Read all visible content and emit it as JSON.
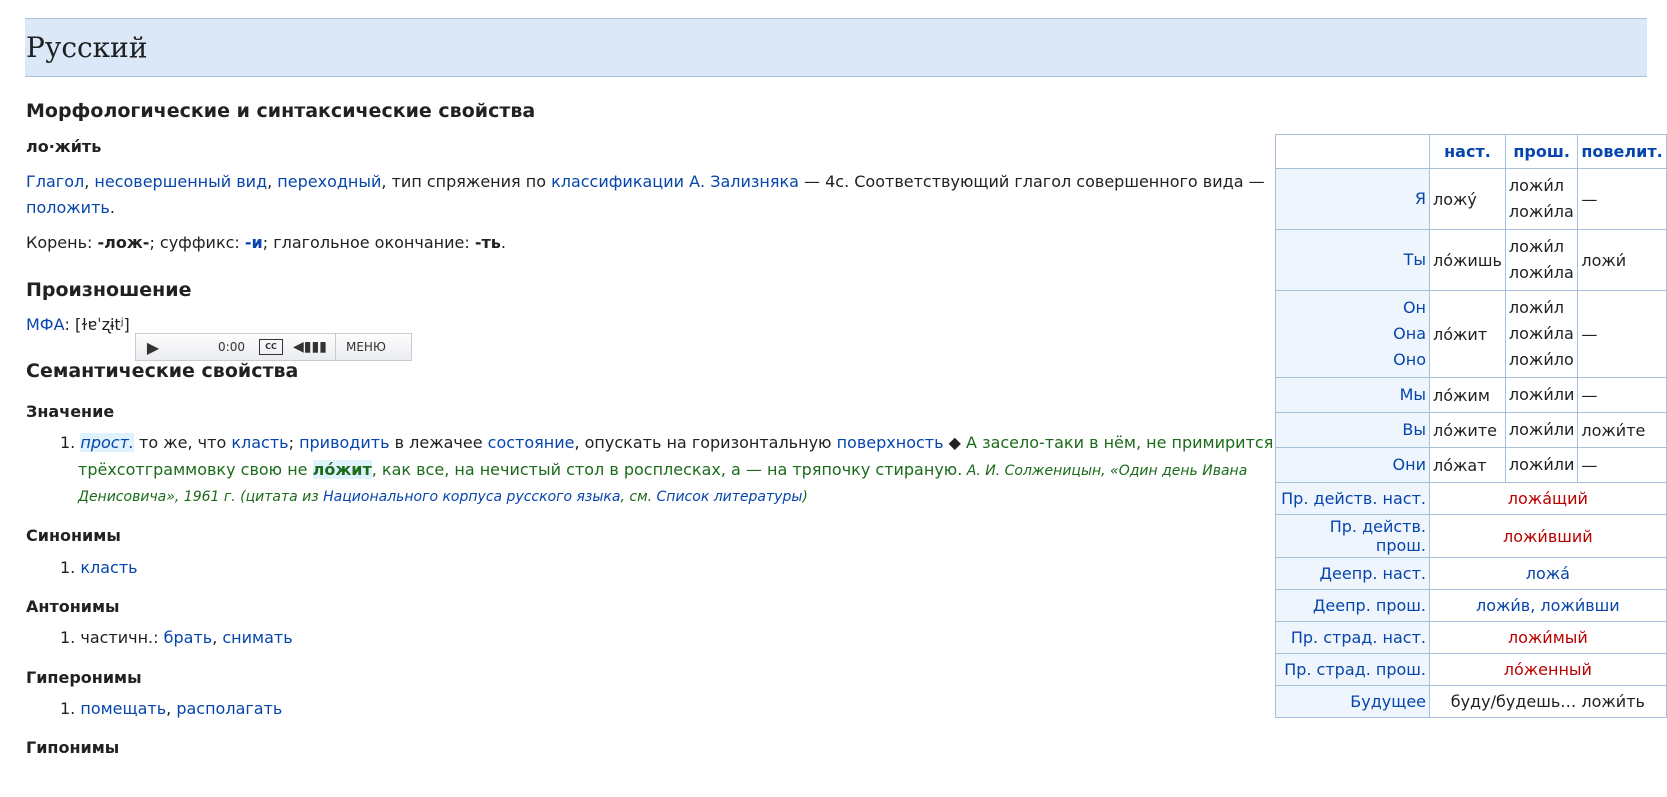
{
  "lang_header": "Русский",
  "section_morph": "Морфологические и синтаксические свойства",
  "word_syll": "ло·жи́ть",
  "morph_line1": {
    "l1": "Глагол",
    "l2": "несовершенный вид",
    "l3": "переходный",
    "t1": ", тип спряжения по ",
    "l4": "классификации А. Зализняка",
    "t2": " — 4c. Соответствующий глагол совершенного вида —"
  },
  "morph_line2": {
    "link": "положить",
    "tail": "."
  },
  "root_line": {
    "t1": "Корень: ",
    "b1": "-лож-",
    "t2": "; суффикс: ",
    "b2": "-и",
    "t3": "; глагольное окончание: ",
    "b3": "-ть",
    "t4": "."
  },
  "section_pron": "Произношение",
  "ipa": {
    "link": "МФА",
    "text": ": [ɫɐˈʐɨtʲ]"
  },
  "player": {
    "time": "0:00",
    "cc": "CC",
    "menu": "МЕНЮ"
  },
  "section_sem": "Семантические свойства",
  "meaning_title": "Значение",
  "meaning": {
    "num": "1.",
    "tag": "прост.",
    "t1": " то же, что ",
    "l1": "класть",
    "t2": "; ",
    "l2": "приводить",
    "t3": " в лежачее ",
    "l3": "состояние",
    "t4": ", опускать на горизонтальную ",
    "l4": "поверхность",
    "t5": " ◆ ",
    "q1": "А засело-таки в нём, не примирится:",
    "q2a": "трёхсотграммовку свою не ",
    "q2b": "ло́жит",
    "q2c": ", как все, на нечистый стол в росплесках, а — на тряпочку стираную.",
    "src1": " А. И. Солженицын, «Один день Ивана",
    "src2": "Денисовича», 1961 г. (цитата из ",
    "src_link1": "Национального корпуса русского языка",
    "src3": ", см. ",
    "src_link2": "Список литературы",
    "src4": ")"
  },
  "syn_title": "Синонимы",
  "syn": {
    "num": "1.",
    "l1": "класть"
  },
  "ant_title": "Антонимы",
  "ant": {
    "num": "1.",
    "t1": "частичн.: ",
    "l1": "брать",
    "sep": ", ",
    "l2": "снимать"
  },
  "hyper_title": "Гиперонимы",
  "hyper": {
    "num": "1.",
    "l1": "помещать",
    "sep": ", ",
    "l2": "располагать"
  },
  "hypo_title": "Гипонимы",
  "conj": {
    "headers": [
      "наст.",
      "прош.",
      "повелит."
    ],
    "rows": [
      {
        "p": [
          "Я"
        ],
        "pres": "ложу́",
        "past": [
          "ложи́л",
          "ложи́ла"
        ],
        "imp": "—"
      },
      {
        "p": [
          "Ты"
        ],
        "pres": "ло́жишь",
        "past": [
          "ложи́л",
          "ложи́ла"
        ],
        "imp": "ложи́"
      },
      {
        "p": [
          "Он",
          "Она",
          "Оно"
        ],
        "pres": "ло́жит",
        "past": [
          "ложи́л",
          "ложи́ла",
          "ложи́ло"
        ],
        "imp": "—"
      },
      {
        "p": [
          "Мы"
        ],
        "pres": "ло́жим",
        "past": [
          "ложи́ли"
        ],
        "imp": "—"
      },
      {
        "p": [
          "Вы"
        ],
        "pres": "ло́жите",
        "past": [
          "ложи́ли"
        ],
        "imp": "ложи́те"
      },
      {
        "p": [
          "Они"
        ],
        "pres": "ло́жат",
        "past": [
          "ложи́ли"
        ],
        "imp": "—"
      }
    ],
    "forms": [
      {
        "label": "Пр. действ. наст.",
        "value": "ложа́щий",
        "style": "red"
      },
      {
        "label": "Пр. действ. прош.",
        "value": "ложи́вший",
        "style": "red"
      },
      {
        "label": "Деепр. наст.",
        "value": "ложа́",
        "style": "blue"
      },
      {
        "label": "Деепр. прош.",
        "value": "ложи́в, ложи́вши",
        "style": "blue"
      },
      {
        "label": "Пр. страд. наст.",
        "value": "ложи́мый",
        "style": "red"
      },
      {
        "label": "Пр. страд. прош.",
        "value": "ло́женный",
        "style": "red"
      },
      {
        "label": "Будущее",
        "value": "буду/будешь… ложи́ть",
        "style": "plain"
      }
    ]
  }
}
